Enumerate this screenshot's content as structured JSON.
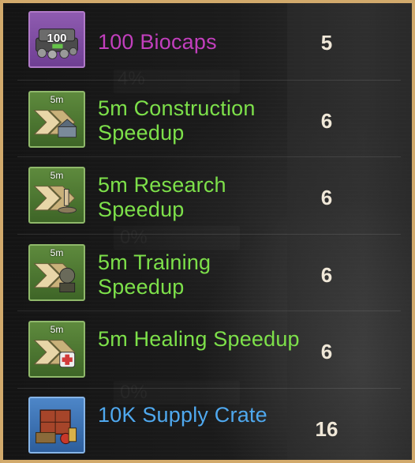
{
  "rewards": [
    {
      "name": "100 Biocaps",
      "qty": "5",
      "rarity": "purple",
      "icon": "biocaps-icon",
      "icon_label": "100"
    },
    {
      "name": "5m Construction Speedup",
      "qty": "6",
      "rarity": "green",
      "icon": "construction-speedup-icon",
      "icon_label": "5m"
    },
    {
      "name": "5m Research Speedup",
      "qty": "6",
      "rarity": "green",
      "icon": "research-speedup-icon",
      "icon_label": "5m"
    },
    {
      "name": "5m Training Speedup",
      "qty": "6",
      "rarity": "green",
      "icon": "training-speedup-icon",
      "icon_label": "5m"
    },
    {
      "name": "5m Healing Speedup",
      "qty": "6",
      "rarity": "green",
      "icon": "healing-speedup-icon",
      "icon_label": "5m"
    },
    {
      "name": "10K Supply Crate",
      "qty": "16",
      "rarity": "blue",
      "icon": "supply-crate-icon",
      "icon_label": ""
    }
  ],
  "background_text": [
    "4%",
    "0%",
    "0%"
  ],
  "colors": {
    "border": "#d2aa6c",
    "purple": "#c23fbd",
    "green": "#7de04a",
    "blue": "#4fa8ee",
    "qty": "#f0e8d8"
  }
}
